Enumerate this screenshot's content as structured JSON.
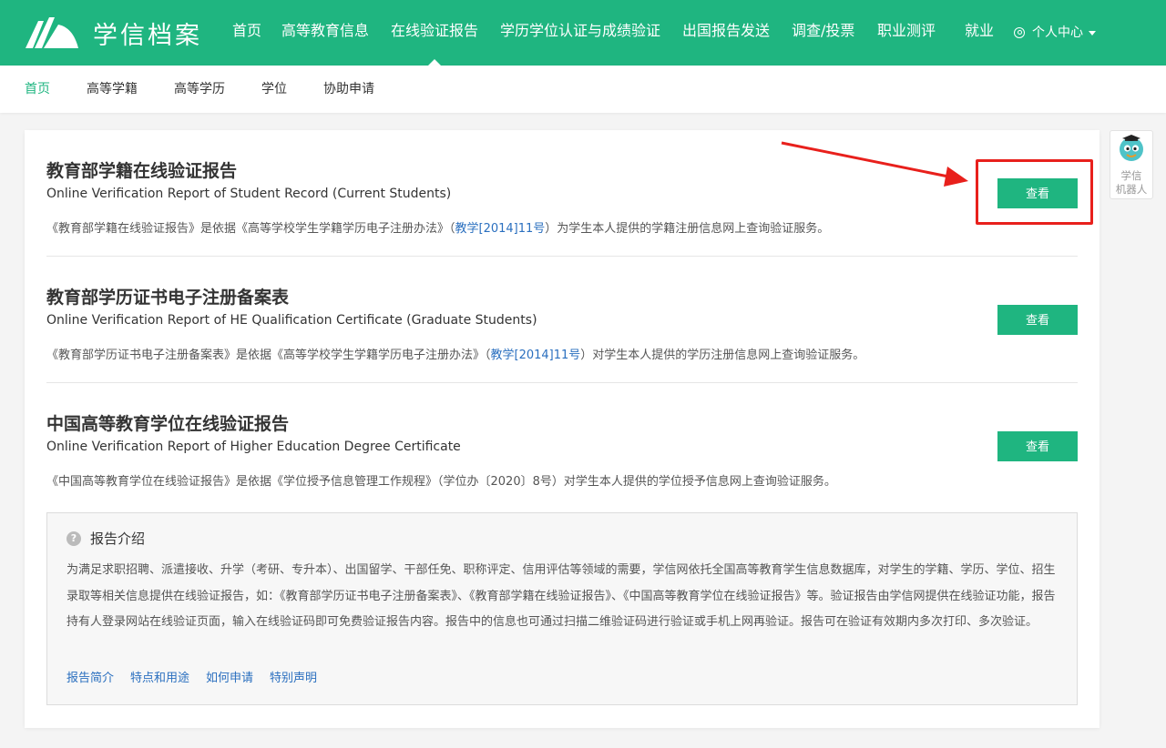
{
  "brand": {
    "logo_text": "学信档案"
  },
  "topnav": {
    "items": [
      "首页",
      "高等教育信息",
      "在线验证报告",
      "学历学位认证与成绩验证",
      "出国报告发送",
      "调查/投票",
      "职业测评",
      "就业"
    ],
    "active": "在线验证报告",
    "user_center": "个人中心"
  },
  "subnav": {
    "items": [
      "首页",
      "高等学籍",
      "高等学历",
      "学位",
      "协助申请"
    ],
    "active": "首页"
  },
  "reports": [
    {
      "title": "教育部学籍在线验证报告",
      "title_en": "Online Verification Report of Student Record (Current Students)",
      "desc_pre": "《教育部学籍在线验证报告》是依据《高等学校学生学籍学历电子注册办法》（",
      "desc_link": "教学[2014]11号",
      "desc_post": "）为学生本人提供的学籍注册信息网上查询验证服务。",
      "button": "查看"
    },
    {
      "title": "教育部学历证书电子注册备案表",
      "title_en": "Online Verification Report of HE Qualification Certificate (Graduate Students)",
      "desc_pre": "《教育部学历证书电子注册备案表》是依据《高等学校学生学籍学历电子注册办法》（",
      "desc_link": "教学[2014]11号",
      "desc_post": "）对学生本人提供的学历注册信息网上查询验证服务。",
      "button": "查看"
    },
    {
      "title": "中国高等教育学位在线验证报告",
      "title_en": "Online Verification Report of Higher Education Degree Certificate",
      "desc_pre": "《中国高等教育学位在线验证报告》是依据《学位授予信息管理工作规程》（学位办〔2020〕8号）对学生本人提供的学位授予信息网上查询验证服务。",
      "desc_link": "",
      "desc_post": "",
      "button": "查看"
    }
  ],
  "intro": {
    "heading": "报告介绍",
    "body": "为满足求职招聘、派遣接收、升学（考研、专升本）、出国留学、干部任免、职称评定、信用评估等领域的需要，学信网依托全国高等教育学生信息数据库，对学生的学籍、学历、学位、招生录取等相关信息提供在线验证报告，如：《教育部学历证书电子注册备案表》、《教育部学籍在线验证报告》、《中国高等教育学位在线验证报告》等。验证报告由学信网提供在线验证功能，报告持有人登录网站在线验证页面，输入在线验证码即可免费验证报告内容。报告中的信息也可通过扫描二维验证码进行验证或手机上网再验证。报告可在验证有效期内多次打印、多次验证。",
    "links": [
      "报告简介",
      "特点和用途",
      "如何申请",
      "特别声明"
    ]
  },
  "robot": {
    "label_line1": "学信",
    "label_line2": "机器人"
  },
  "colors": {
    "brand_green": "#1fb580",
    "link_blue": "#2a6fbf",
    "annotation_red": "#e8201c"
  }
}
